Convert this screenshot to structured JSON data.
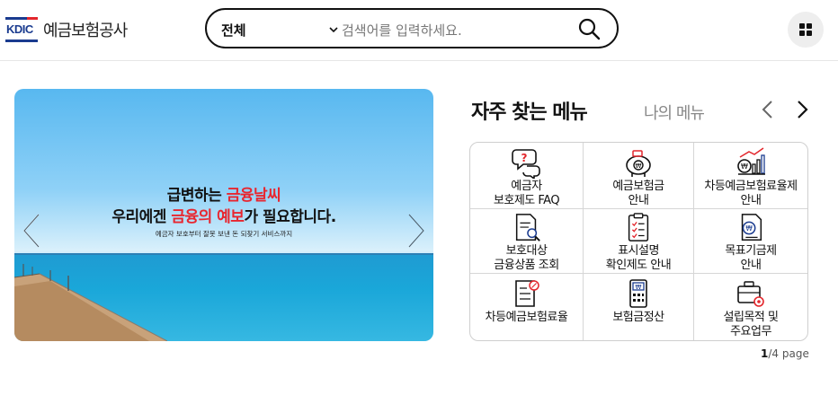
{
  "header": {
    "logo_en": "KDIC",
    "logo_ko": "예금보험공사",
    "search": {
      "select_value": "전체",
      "placeholder": "검색어를 입력하세요."
    },
    "menu_icon": "grid-icon"
  },
  "banner": {
    "line1_a": "급변하는 ",
    "line1_hl": "금융날씨",
    "line2_a": "우리에겐 ",
    "line2_hl": "금융의 예보",
    "line2_b": "가 필요합니다.",
    "sub": "예금자 보호부터 잘못 보낸 돈 되찾기 서비스까지",
    "highlight_color": "#e8262f"
  },
  "menu": {
    "title": "자주 찾는 메뉴",
    "tab2": "나의 메뉴",
    "items": [
      {
        "label": "예금자\n보호제도 FAQ",
        "icon": "faq-icon"
      },
      {
        "label": "예금보험금\n안내",
        "icon": "piggy-bank-icon"
      },
      {
        "label": "차등예금보험료율제\n안내",
        "icon": "rate-chart-icon"
      },
      {
        "label": "보호대상\n금융상품 조회",
        "icon": "document-search-icon"
      },
      {
        "label": "표시설명\n확인제도 안내",
        "icon": "checklist-icon"
      },
      {
        "label": "목표기금제\n안내",
        "icon": "fund-document-icon"
      },
      {
        "label": "차등예금보험료율",
        "icon": "rate-document-icon"
      },
      {
        "label": "보험금정산",
        "icon": "calculator-icon"
      },
      {
        "label": "설립목적 및\n주요업무",
        "icon": "briefcase-gear-icon"
      }
    ],
    "page_current": "1",
    "page_rest": "/4 page"
  }
}
